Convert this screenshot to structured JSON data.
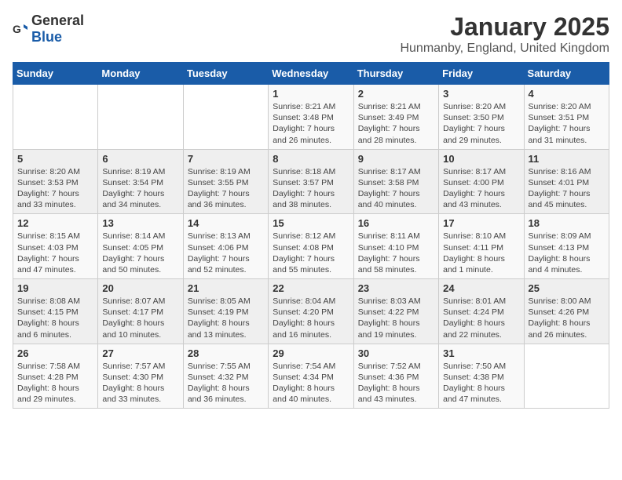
{
  "logo": {
    "general": "General",
    "blue": "Blue"
  },
  "title": "January 2025",
  "subtitle": "Hunmanby, England, United Kingdom",
  "headers": [
    "Sunday",
    "Monday",
    "Tuesday",
    "Wednesday",
    "Thursday",
    "Friday",
    "Saturday"
  ],
  "weeks": [
    [
      {
        "day": "",
        "info": ""
      },
      {
        "day": "",
        "info": ""
      },
      {
        "day": "",
        "info": ""
      },
      {
        "day": "1",
        "info": "Sunrise: 8:21 AM\nSunset: 3:48 PM\nDaylight: 7 hours and 26 minutes."
      },
      {
        "day": "2",
        "info": "Sunrise: 8:21 AM\nSunset: 3:49 PM\nDaylight: 7 hours and 28 minutes."
      },
      {
        "day": "3",
        "info": "Sunrise: 8:20 AM\nSunset: 3:50 PM\nDaylight: 7 hours and 29 minutes."
      },
      {
        "day": "4",
        "info": "Sunrise: 8:20 AM\nSunset: 3:51 PM\nDaylight: 7 hours and 31 minutes."
      }
    ],
    [
      {
        "day": "5",
        "info": "Sunrise: 8:20 AM\nSunset: 3:53 PM\nDaylight: 7 hours and 33 minutes."
      },
      {
        "day": "6",
        "info": "Sunrise: 8:19 AM\nSunset: 3:54 PM\nDaylight: 7 hours and 34 minutes."
      },
      {
        "day": "7",
        "info": "Sunrise: 8:19 AM\nSunset: 3:55 PM\nDaylight: 7 hours and 36 minutes."
      },
      {
        "day": "8",
        "info": "Sunrise: 8:18 AM\nSunset: 3:57 PM\nDaylight: 7 hours and 38 minutes."
      },
      {
        "day": "9",
        "info": "Sunrise: 8:17 AM\nSunset: 3:58 PM\nDaylight: 7 hours and 40 minutes."
      },
      {
        "day": "10",
        "info": "Sunrise: 8:17 AM\nSunset: 4:00 PM\nDaylight: 7 hours and 43 minutes."
      },
      {
        "day": "11",
        "info": "Sunrise: 8:16 AM\nSunset: 4:01 PM\nDaylight: 7 hours and 45 minutes."
      }
    ],
    [
      {
        "day": "12",
        "info": "Sunrise: 8:15 AM\nSunset: 4:03 PM\nDaylight: 7 hours and 47 minutes."
      },
      {
        "day": "13",
        "info": "Sunrise: 8:14 AM\nSunset: 4:05 PM\nDaylight: 7 hours and 50 minutes."
      },
      {
        "day": "14",
        "info": "Sunrise: 8:13 AM\nSunset: 4:06 PM\nDaylight: 7 hours and 52 minutes."
      },
      {
        "day": "15",
        "info": "Sunrise: 8:12 AM\nSunset: 4:08 PM\nDaylight: 7 hours and 55 minutes."
      },
      {
        "day": "16",
        "info": "Sunrise: 8:11 AM\nSunset: 4:10 PM\nDaylight: 7 hours and 58 minutes."
      },
      {
        "day": "17",
        "info": "Sunrise: 8:10 AM\nSunset: 4:11 PM\nDaylight: 8 hours and 1 minute."
      },
      {
        "day": "18",
        "info": "Sunrise: 8:09 AM\nSunset: 4:13 PM\nDaylight: 8 hours and 4 minutes."
      }
    ],
    [
      {
        "day": "19",
        "info": "Sunrise: 8:08 AM\nSunset: 4:15 PM\nDaylight: 8 hours and 6 minutes."
      },
      {
        "day": "20",
        "info": "Sunrise: 8:07 AM\nSunset: 4:17 PM\nDaylight: 8 hours and 10 minutes."
      },
      {
        "day": "21",
        "info": "Sunrise: 8:05 AM\nSunset: 4:19 PM\nDaylight: 8 hours and 13 minutes."
      },
      {
        "day": "22",
        "info": "Sunrise: 8:04 AM\nSunset: 4:20 PM\nDaylight: 8 hours and 16 minutes."
      },
      {
        "day": "23",
        "info": "Sunrise: 8:03 AM\nSunset: 4:22 PM\nDaylight: 8 hours and 19 minutes."
      },
      {
        "day": "24",
        "info": "Sunrise: 8:01 AM\nSunset: 4:24 PM\nDaylight: 8 hours and 22 minutes."
      },
      {
        "day": "25",
        "info": "Sunrise: 8:00 AM\nSunset: 4:26 PM\nDaylight: 8 hours and 26 minutes."
      }
    ],
    [
      {
        "day": "26",
        "info": "Sunrise: 7:58 AM\nSunset: 4:28 PM\nDaylight: 8 hours and 29 minutes."
      },
      {
        "day": "27",
        "info": "Sunrise: 7:57 AM\nSunset: 4:30 PM\nDaylight: 8 hours and 33 minutes."
      },
      {
        "day": "28",
        "info": "Sunrise: 7:55 AM\nSunset: 4:32 PM\nDaylight: 8 hours and 36 minutes."
      },
      {
        "day": "29",
        "info": "Sunrise: 7:54 AM\nSunset: 4:34 PM\nDaylight: 8 hours and 40 minutes."
      },
      {
        "day": "30",
        "info": "Sunrise: 7:52 AM\nSunset: 4:36 PM\nDaylight: 8 hours and 43 minutes."
      },
      {
        "day": "31",
        "info": "Sunrise: 7:50 AM\nSunset: 4:38 PM\nDaylight: 8 hours and 47 minutes."
      },
      {
        "day": "",
        "info": ""
      }
    ]
  ]
}
